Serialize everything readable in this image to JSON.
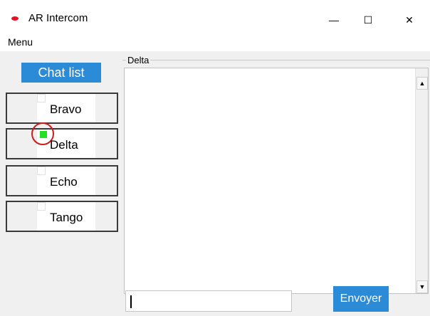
{
  "window": {
    "title": "AR Intercom",
    "minimize_glyph": "—",
    "maximize_glyph": "☐",
    "close_glyph": "✕"
  },
  "menu": {
    "items": [
      {
        "label": "Menu"
      }
    ]
  },
  "sidebar": {
    "chat_list_label": "Chat list",
    "contacts": [
      {
        "name": "Bravo",
        "online": false
      },
      {
        "name": "Delta",
        "online": true
      },
      {
        "name": "Echo",
        "online": false
      },
      {
        "name": "Tango",
        "online": false
      }
    ]
  },
  "chat": {
    "group_label": "Delta",
    "scroll_up_glyph": "▲",
    "scroll_down_glyph": "▼",
    "input_value": "",
    "send_label": "Envoyer"
  },
  "colors": {
    "accent": "#2b8bd6",
    "online": "#22e022",
    "highlight_ring": "#d11a1a",
    "app_icon": "#e81123"
  }
}
